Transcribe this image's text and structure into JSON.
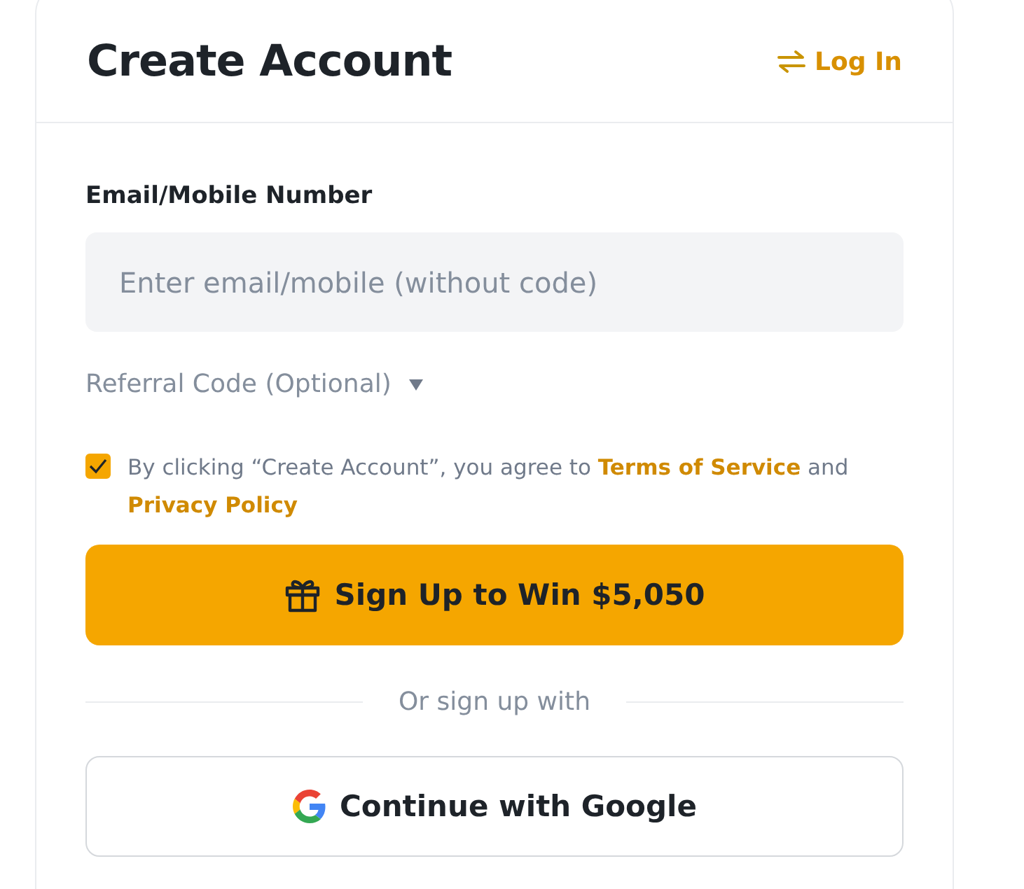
{
  "header": {
    "title": "Create Account",
    "login_link": "Log In"
  },
  "email_field": {
    "label": "Email/Mobile Number",
    "placeholder": "Enter email/mobile (without code)"
  },
  "referral_toggle": {
    "label": "Referral Code (Optional)",
    "expanded": false
  },
  "agreement": {
    "checked": true,
    "text": "By clicking “Create Account”, you agree to",
    "terms_link": "Terms of Service",
    "joiner": "and",
    "privacy_link": "Privacy Policy"
  },
  "signup_button": "Sign Up to Win $5,050",
  "divider_text": "Or sign up with",
  "google_button": "Continue with Google"
}
